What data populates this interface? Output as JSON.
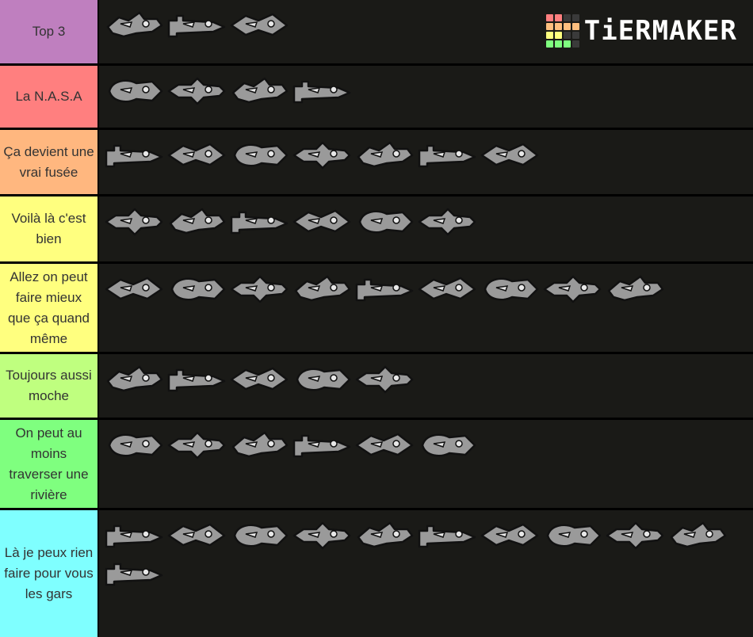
{
  "logo": {
    "text": "TiERMAKER",
    "grid_colors": [
      "#ff7f7f",
      "#ff7f7f",
      "#3a3a3a",
      "#3a3a3a",
      "#ffbf7f",
      "#ffbf7f",
      "#ffbf7f",
      "#ffbf7f",
      "#ffff7f",
      "#ffff7f",
      "#3a3a3a",
      "#3a3a3a",
      "#7fff7f",
      "#7fff7f",
      "#7fff7f",
      "#3a3a3a"
    ]
  },
  "tiers": [
    {
      "label": "Top 3",
      "color": "#bf7fbf",
      "items": [
        "spiky-dragon-ship",
        "seahorse-ship",
        "spiky-fish-ship"
      ]
    },
    {
      "label": "La N.A.S.A",
      "color": "#ff7f7f",
      "items": [
        "block-rocket-ship",
        "blade-ship",
        "winged-jet-ship",
        "hex-drill-ship"
      ]
    },
    {
      "label": "Ça devient une vrai fusée",
      "color": "#ffb77f",
      "items": [
        "mech-claw-ship",
        "gear-claw-ship",
        "delta-jet-ship",
        "striped-wing-ship",
        "shard-ship",
        "cannon-ship",
        "horned-dragon-ship"
      ]
    },
    {
      "label": "Voilà là c'est bien",
      "color": "#ffff7f",
      "items": [
        "frog-rocket-ship",
        "porthole-rocket-ship",
        "checker-wing-ship",
        "arrow-wing-ship",
        "angular-fish-ship",
        "twin-fin-ship"
      ]
    },
    {
      "label": "Allez on peut faire mieux que ça quand même",
      "color": "#ffff7f",
      "items": [
        "flame-fish-ship",
        "geo-fish-ship",
        "shark-ship",
        "grin-ship",
        "hull-ship",
        "whale-ship",
        "spiky-bird-ship",
        "diamond-rocket-ship",
        "pointed-rocket-ship"
      ]
    },
    {
      "label": "Toujours aussi moche",
      "color": "#bfff7f",
      "items": [
        "croc-dog-ship",
        "geo-shark-ship",
        "dotted-rocket-ship",
        "arrow-rocket-ship",
        "dragon-skull-ship"
      ]
    },
    {
      "label": "On peut au moins traverser une rivière",
      "color": "#7fff7f",
      "items": [
        "arrow-fish-ship",
        "circle-arrow-ship",
        "jaw-ship",
        "bone-fish-ship",
        "scissors-ship",
        "submarine-ship"
      ]
    },
    {
      "label": "Là je peux rien faire pour vous les gars",
      "color": "#7fffff",
      "items": [
        "pacman-drill-ship",
        "dino-skull-ship",
        "robot-head-ship",
        "zigzag-ship",
        "dome-ship",
        "robot-mouth-ship",
        "cat-ship",
        "bird-squid-ship",
        "rocket-cone-ship",
        "gatling-ship",
        "dna-helix-ship"
      ]
    }
  ]
}
